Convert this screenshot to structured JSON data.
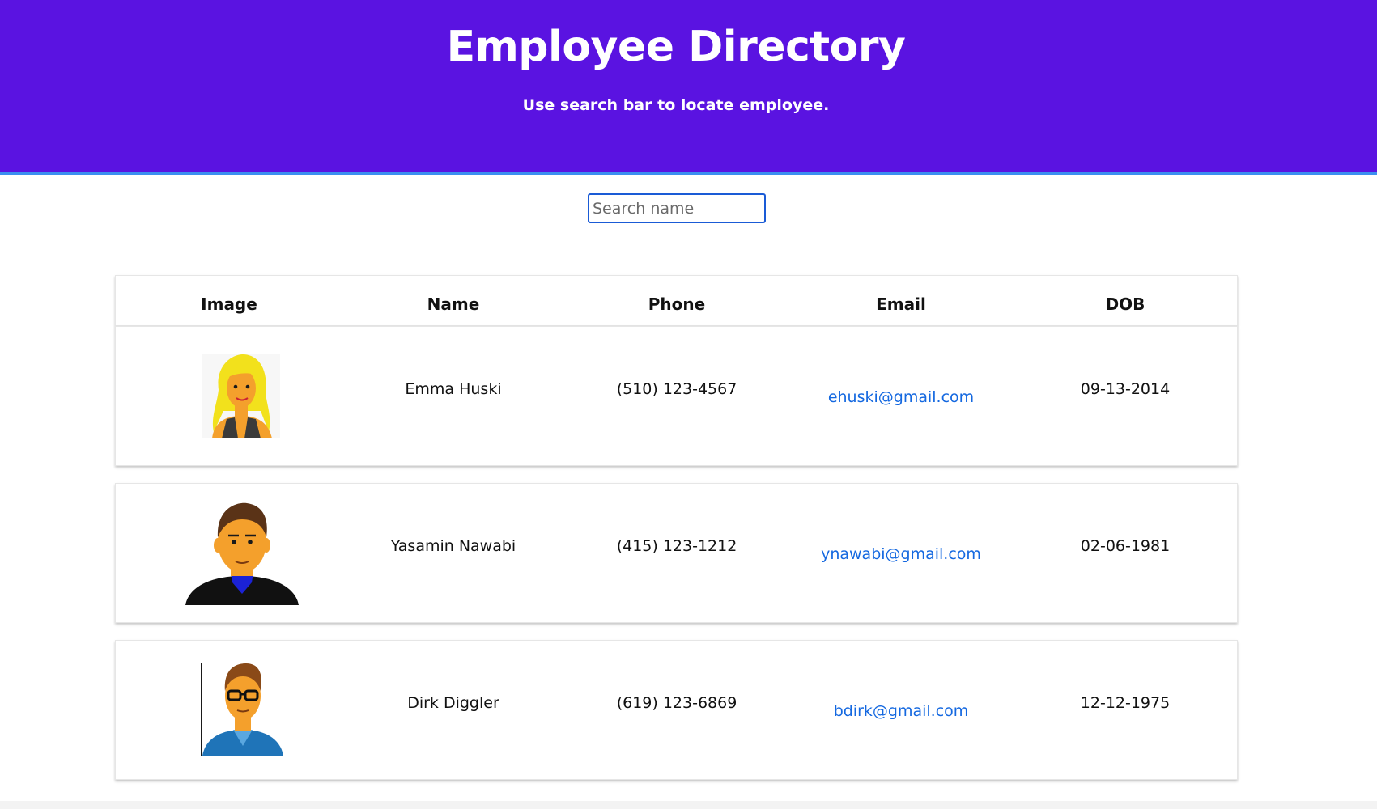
{
  "header": {
    "title": "Employee Directory",
    "subtitle": "Use search bar to locate employee."
  },
  "search": {
    "placeholder": "Search name",
    "value": ""
  },
  "table": {
    "columns": [
      "Image",
      "Name",
      "Phone",
      "Email",
      "DOB"
    ],
    "rows": [
      {
        "avatar": "woman-blonde-avatar-icon",
        "name": "Emma Huski",
        "phone": "(510) 123-4567",
        "email": "ehuski@gmail.com",
        "dob": "09-13-2014"
      },
      {
        "avatar": "man-dark-shirt-avatar-icon",
        "name": "Yasamin Nawabi",
        "phone": "(415) 123-1212",
        "email": "ynawabi@gmail.com",
        "dob": "02-06-1981"
      },
      {
        "avatar": "man-glasses-avatar-icon",
        "name": "Dirk Diggler",
        "phone": "(619) 123-6869",
        "email": "bdirk@gmail.com",
        "dob": "12-12-1975"
      }
    ]
  },
  "colors": {
    "header_bg": "#5a13e1",
    "header_border": "#3b8ff0",
    "link": "#1468e0"
  }
}
